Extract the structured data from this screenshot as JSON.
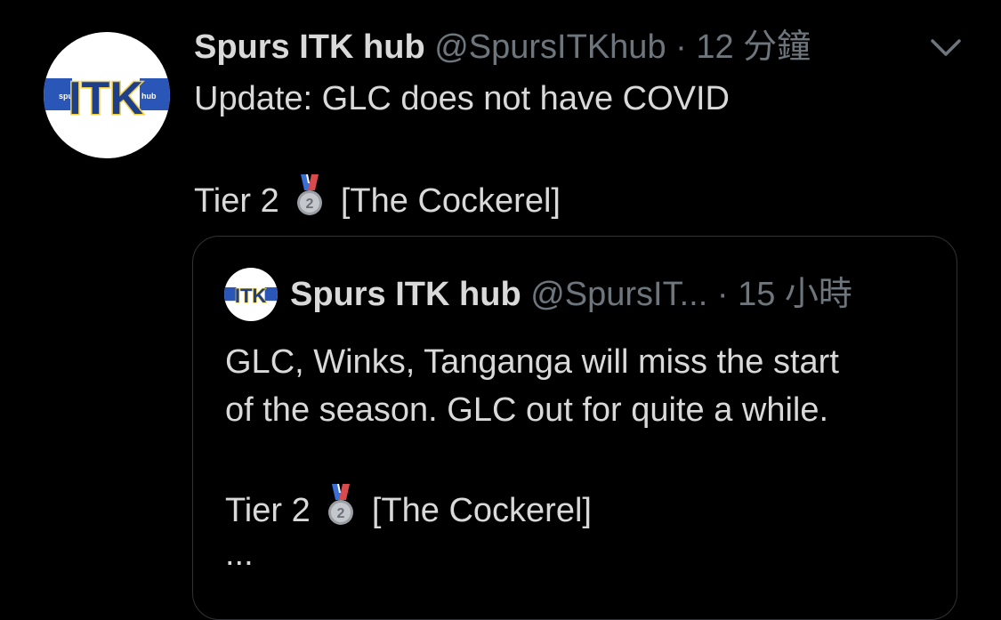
{
  "tweet": {
    "author_name": "Spurs ITK hub",
    "handle": "@SpursITKhub",
    "separator": "·",
    "time": "12 分鐘",
    "text_line1": "Update: GLC does not have COVID",
    "tier_label": "Tier 2",
    "source": "[The Cockerel]",
    "menu_icon": "chevron-down-icon"
  },
  "quoted": {
    "author_name": "Spurs ITK hub",
    "handle": "@SpursIT...",
    "separator": "·",
    "time": "15 小時",
    "text_line1": "GLC, Winks, Tanganga will miss the start",
    "text_line2": "of the season. GLC out for quite a while.",
    "tier_label": "Tier 2",
    "source": "[The Cockerel]",
    "ellipsis": "..."
  },
  "avatar_logo": {
    "left_word": "spurs",
    "center_word": "ITK",
    "right_word": "hub",
    "band_color": "#2a56b8",
    "letter_color": "#1e3f8c",
    "letter_outline": "#f4d03f"
  },
  "colors": {
    "background": "#000000",
    "primary_text": "#d9d9d9",
    "secondary_text": "#6e767d",
    "border": "#2f3336"
  }
}
